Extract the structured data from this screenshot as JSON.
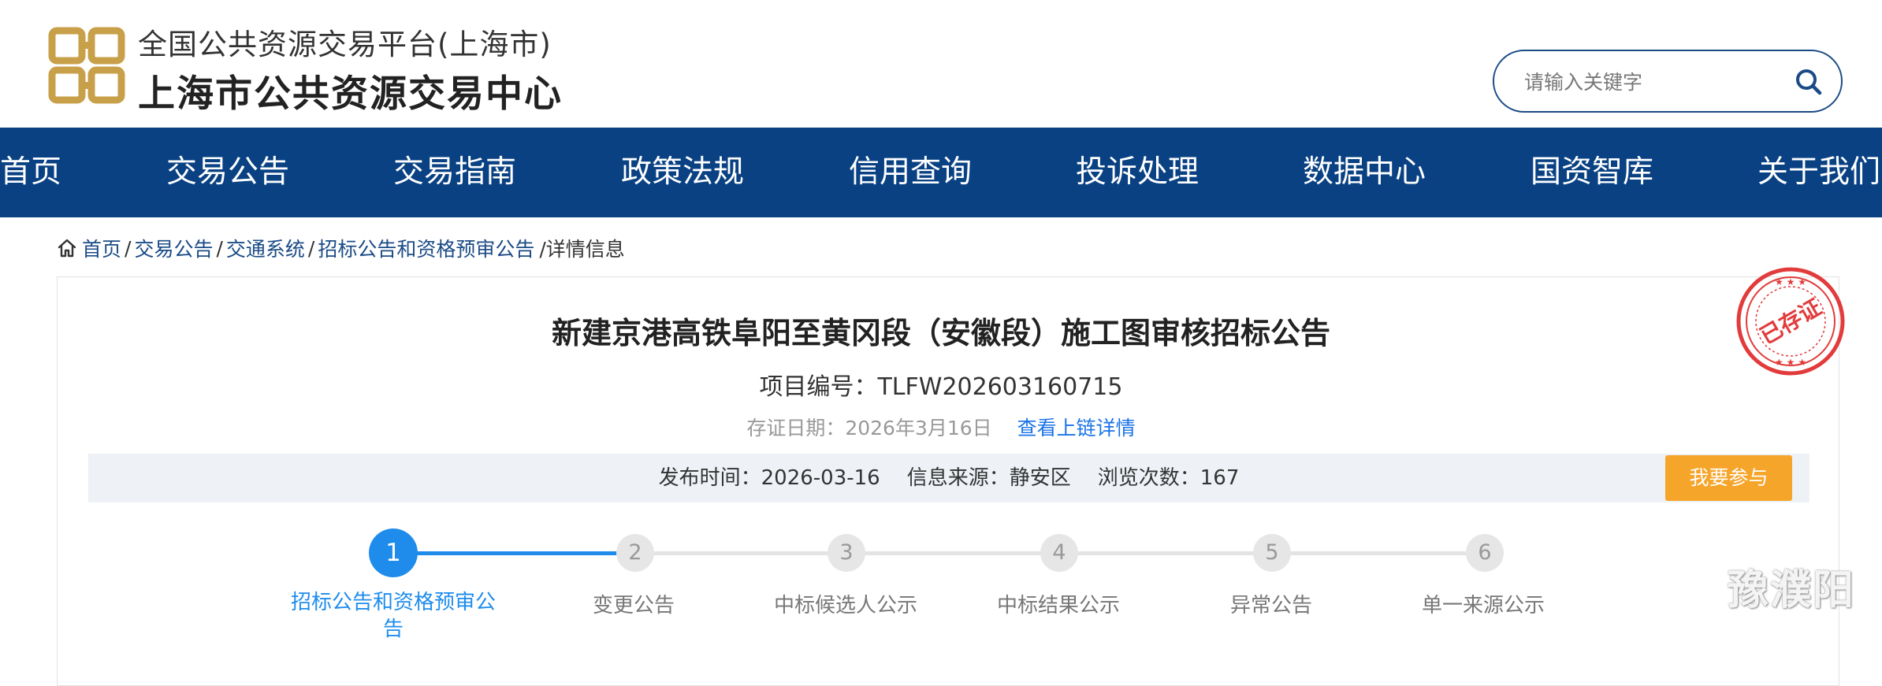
{
  "header": {
    "logo_subtitle": "全国公共资源交易平台(上海市)",
    "logo_title": "上海市公共资源交易中心",
    "search_placeholder": "请输入关键字"
  },
  "nav": {
    "items": [
      "首页",
      "交易公告",
      "交易指南",
      "政策法规",
      "信用查询",
      "投诉处理",
      "数据中心",
      "国资智库",
      "关于我们"
    ]
  },
  "breadcrumb": {
    "items": [
      "首页",
      "交易公告",
      "交通系统",
      "招标公告和资格预审公告"
    ],
    "separator": "/",
    "current": "/详情信息"
  },
  "article": {
    "title": "新建京港高铁阜阳至黄冈段（安徽段）施工图审核招标公告",
    "project_no": "项目编号：TLFW202603160715",
    "cert_date": "存证日期：2026年3月16日",
    "cert_link": "查看上链详情",
    "stamp_text": "已存证",
    "publish_time": "发布时间：2026-03-16",
    "source": "信息来源：静安区",
    "views": "浏览次数：167",
    "join_button": "我要参与"
  },
  "steps": [
    {
      "num": "1",
      "label": "招标公告和资格预审公告",
      "active": true
    },
    {
      "num": "2",
      "label": "变更公告",
      "active": false
    },
    {
      "num": "3",
      "label": "中标候选人公示",
      "active": false
    },
    {
      "num": "4",
      "label": "中标结果公示",
      "active": false
    },
    {
      "num": "5",
      "label": "异常公告",
      "active": false
    },
    {
      "num": "6",
      "label": "单一来源公示",
      "active": false
    }
  ],
  "watermark": "豫濮阳",
  "colors": {
    "nav_bg": "#094183",
    "primary_blue": "#1f8ceb",
    "join_orange": "#f5a52a",
    "stamp_red": "#e23b3b"
  }
}
